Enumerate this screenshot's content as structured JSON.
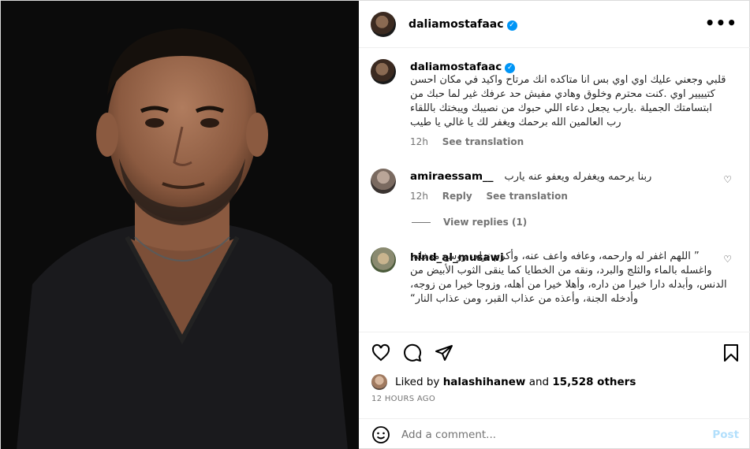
{
  "post": {
    "username": "daliamostafaac",
    "more_icon": "more-horizontal-icon"
  },
  "caption": {
    "username": "daliamostafaac",
    "text": "قلبي وجعني عليك اوي اوي بس انا متاكده انك مرتاح واكيد في مكان احسن كتيييير اوي .كنت محترم وخلوق وهادي مفيش حد عرفك غير لما حبك من ابتسامتك الجميلة .يارب يجعل دعاء اللي حبوك من نصيبك ويبختك باللقاء رب العالمين الله برحمك ويغفر لك يا غالي يا طيب",
    "time": "12h",
    "see_translation": "See translation"
  },
  "comments": [
    {
      "username": "amiraessam__",
      "text": "ربنا يرحمه ويغفرله ويعفو عنه يارب",
      "time": "12h",
      "reply": "Reply",
      "see_translation": "See translation",
      "view_replies": "View replies (1)"
    },
    {
      "username": "hind_al_musawi",
      "text": "” اللهم اغفر له وارحمه، وعافه واعف عنه، وأكرم نزله، ووسع مدخله، واغسله بالماء والثلج والبرد، ونقه من الخطايا كما ينقى الثوب الأبيض من الدنس، وأبدله دارا خيرا من داره، وأهلا خيرا من أهله، وزوجا خيرا من زوجه، وأدخله الجنة، وأعذه من عذاب القبر، ومن عذاب النار“"
    }
  ],
  "likes": {
    "prefix": "Liked by",
    "user": "halashihanew",
    "joiner": "and",
    "others": "15,528 others"
  },
  "time_ago": "12 HOURS AGO",
  "add_comment": {
    "placeholder": "Add a comment...",
    "post_label": "Post"
  }
}
